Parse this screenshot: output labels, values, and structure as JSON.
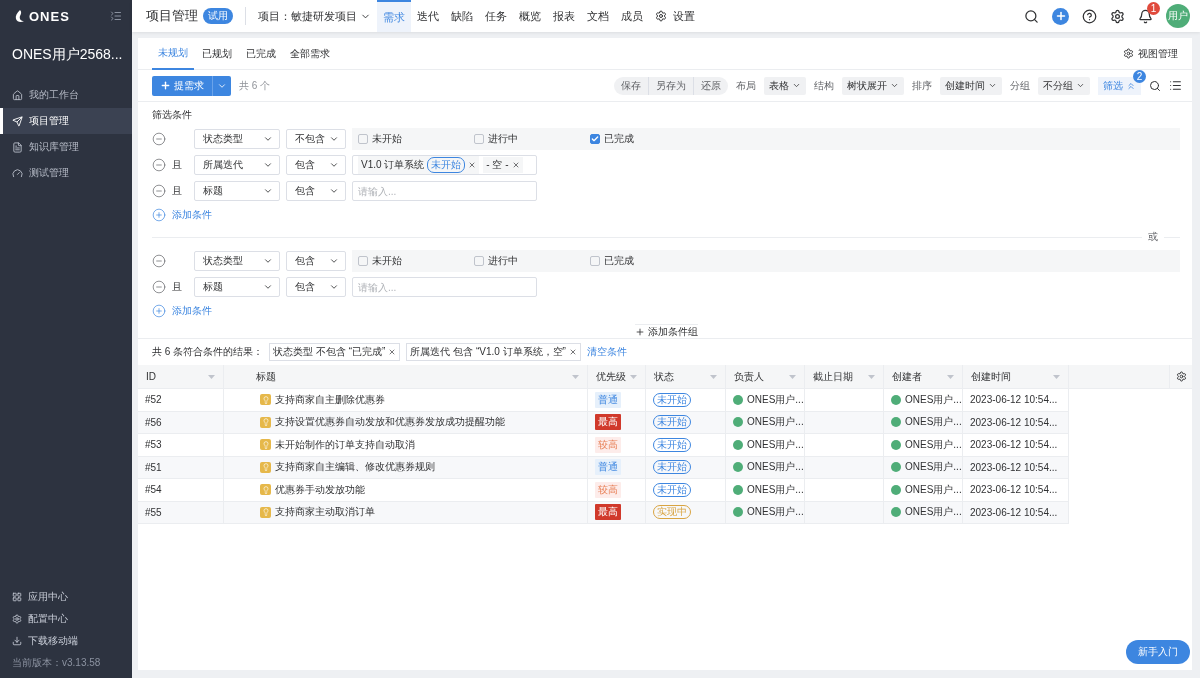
{
  "sidebar": {
    "logo": "ONES",
    "user": "ONES用户2568...",
    "items": [
      {
        "label": "我的工作台",
        "selected": false
      },
      {
        "label": "项目管理",
        "selected": true
      },
      {
        "label": "知识库管理",
        "selected": false
      },
      {
        "label": "测试管理",
        "selected": false
      }
    ],
    "bottom_items": [
      "应用中心",
      "配置中心",
      "下载移动端"
    ],
    "version": "当前版本：v3.13.58"
  },
  "header": {
    "title": "项目管理",
    "badge": "试用",
    "project": "项目：敏捷研发项目",
    "nav": [
      {
        "label": "需求",
        "selected": true
      },
      {
        "label": "迭代",
        "selected": false
      },
      {
        "label": "缺陷",
        "selected": false
      },
      {
        "label": "任务",
        "selected": false
      },
      {
        "label": "概览",
        "selected": false
      },
      {
        "label": "报表",
        "selected": false
      },
      {
        "label": "文档",
        "selected": false
      },
      {
        "label": "成员",
        "selected": false
      },
      {
        "label": "设置",
        "selected": false,
        "kind": "settings"
      }
    ],
    "notifications": "1",
    "avatar": "用户"
  },
  "tabs": [
    {
      "label": "未规划",
      "selected": true
    },
    {
      "label": "已规划",
      "selected": false
    },
    {
      "label": "已完成",
      "selected": false
    },
    {
      "label": "全部需求",
      "selected": false
    }
  ],
  "view_manage": "视图管理",
  "toolbar": {
    "create": "提需求",
    "count": "共 6 个",
    "actions": [
      "保存",
      "另存为",
      "还原"
    ],
    "options": [
      {
        "label": "布局",
        "value": "表格"
      },
      {
        "label": "结构",
        "value": "树状展开"
      },
      {
        "label": "排序",
        "value": "创建时间"
      },
      {
        "label": "分组",
        "value": "不分组"
      }
    ],
    "filter": "筛选",
    "filter_count": "2"
  },
  "filter": {
    "title": "筛选条件",
    "separator": "或",
    "add_group": "添加条件组",
    "groups": [
      {
        "conditions": [
          {
            "field": "状态类型",
            "operator": "不包含",
            "kind": "checkboxes",
            "options": [
              {
                "label": "未开始",
                "checked": false
              },
              {
                "label": "进行中",
                "checked": false
              },
              {
                "label": "已完成",
                "checked": true
              }
            ]
          },
          {
            "conjunction": "且",
            "field": "所属迭代",
            "operator": "包含",
            "kind": "tags",
            "tags": [
              {
                "label": "V1.0 订单系统",
                "status": "未开始"
              },
              {
                "label": "- 空 -"
              }
            ]
          },
          {
            "conjunction": "且",
            "field": "标题",
            "operator": "包含",
            "kind": "text",
            "placeholder": "请输入..."
          }
        ],
        "add_condition": "添加条件"
      },
      {
        "conditions": [
          {
            "field": "状态类型",
            "operator": "包含",
            "kind": "checkboxes",
            "options": [
              {
                "label": "未开始",
                "checked": false
              },
              {
                "label": "进行中",
                "checked": false
              },
              {
                "label": "已完成",
                "checked": false
              }
            ]
          },
          {
            "conjunction": "且",
            "field": "标题",
            "operator": "包含",
            "kind": "text",
            "placeholder": "请输入..."
          }
        ],
        "add_condition": "添加条件"
      }
    ]
  },
  "results": {
    "summary": "共 6 条符合条件的结果：",
    "chips": [
      "状态类型 不包含 “已完成”",
      "所属迭代 包含 “V1.0 订单系统，空”"
    ],
    "clear": "清空条件"
  },
  "table": {
    "columns": [
      "ID",
      "标题",
      "优先级",
      "状态",
      "负责人",
      "截止日期",
      "创建者",
      "创建时间"
    ],
    "rows": [
      {
        "id": "#52",
        "title": "支持商家自主删除优惠券",
        "priority": {
          "label": "普通",
          "kind": "normal"
        },
        "status": {
          "label": "未开始",
          "kind": "todo"
        },
        "assignee": "ONES用户...",
        "creator": "ONES用户...",
        "created": "2023-06-12 10:54..."
      },
      {
        "id": "#56",
        "title": "支持设置优惠券自动发放和优惠券发放成功提醒功能",
        "priority": {
          "label": "最高",
          "kind": "highest"
        },
        "status": {
          "label": "未开始",
          "kind": "todo"
        },
        "assignee": "ONES用户...",
        "creator": "ONES用户...",
        "created": "2023-06-12 10:54..."
      },
      {
        "id": "#53",
        "title": "未开始制作的订单支持自动取消",
        "priority": {
          "label": "较高",
          "kind": "high"
        },
        "status": {
          "label": "未开始",
          "kind": "todo"
        },
        "assignee": "ONES用户...",
        "creator": "ONES用户...",
        "created": "2023-06-12 10:54..."
      },
      {
        "id": "#51",
        "title": "支持商家自主编辑、修改优惠券规则",
        "priority": {
          "label": "普通",
          "kind": "normal"
        },
        "status": {
          "label": "未开始",
          "kind": "todo"
        },
        "assignee": "ONES用户...",
        "creator": "ONES用户...",
        "created": "2023-06-12 10:54..."
      },
      {
        "id": "#54",
        "title": "优惠券手动发放功能",
        "priority": {
          "label": "较高",
          "kind": "high"
        },
        "status": {
          "label": "未开始",
          "kind": "todo"
        },
        "assignee": "ONES用户...",
        "creator": "ONES用户...",
        "created": "2023-06-12 10:54..."
      },
      {
        "id": "#55",
        "title": "支持商家主动取消订单",
        "priority": {
          "label": "最高",
          "kind": "highest"
        },
        "status": {
          "label": "实现中",
          "kind": "doing"
        },
        "assignee": "ONES用户...",
        "creator": "ONES用户...",
        "created": "2023-06-12 10:54..."
      }
    ]
  },
  "help_button": "新手入门"
}
